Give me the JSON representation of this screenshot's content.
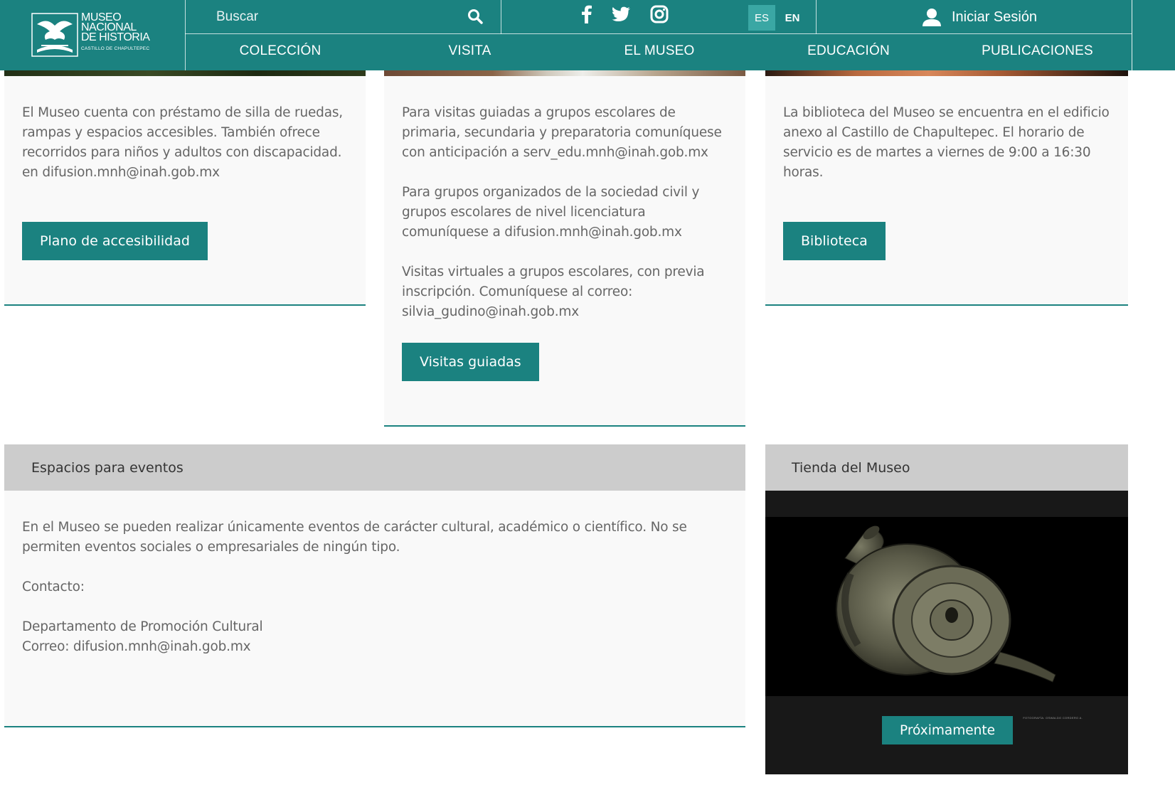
{
  "header": {
    "logo": {
      "line1": "MUSEO",
      "line2": "NACIONAL",
      "line3": "DE HISTORIA",
      "line4": "CASTILLO DE CHAPULTEPEC"
    },
    "search": {
      "placeholder": "Buscar"
    },
    "social": [
      "facebook-icon",
      "twitter-icon",
      "instagram-icon"
    ],
    "languages": {
      "es": "ES",
      "en": "EN"
    },
    "login_label": "Iniciar Sesión",
    "nav": [
      "COLECCIÓN",
      "VISITA",
      "EL MUSEO",
      "EDUCACIÓN",
      "PUBLICACIONES"
    ]
  },
  "cards": {
    "accessibility": {
      "text": "El Museo cuenta con préstamo de silla de ruedas, rampas y espacios accesibles. También ofrece recorridos para niños y adultos con discapacidad. en difusion.mnh@inah.gob.mx",
      "button": "Plano de accesibilidad"
    },
    "visits": {
      "p1": "Para visitas guiadas a grupos escolares de primaria, secundaria y preparatoria comuníquese con anticipación a serv_edu.mnh@inah.gob.mx",
      "p2": "Para grupos organizados de la sociedad civil y grupos escolares de nivel licenciatura comuníquese a difusion.mnh@inah.gob.mx",
      "p3": "Visitas virtuales a grupos escolares, con previa inscripción.  Comuníquese   al correo: silvia_gudino@inah.gob.mx",
      "button": "Visitas guiadas"
    },
    "library": {
      "text": "La biblioteca del Museo se encuentra en el edificio anexo al Castillo de Chapultepec. El horario de servicio es de martes a viernes de 9:00 a 16:30 horas.",
      "button": "Biblioteca"
    }
  },
  "events": {
    "title": "Espacios para eventos",
    "p1": "En el Museo se pueden realizar únicamente eventos de carácter cultural, académico o científico. No se permiten eventos sociales o empresariales de ningún tipo.",
    "p2": "Contacto:",
    "p3_line1": "Departamento de Promoción Cultural",
    "p3_line2": "Correo: difusion.mnh@inah.gob.mx"
  },
  "shop": {
    "title": "Tienda del Museo",
    "photo_credit": "FOTOGRAFÍA: OSWALDO CORDERO A.",
    "button": "Próximamente"
  },
  "colors": {
    "accent": "#1b8280",
    "card_bg": "#f9f9f9",
    "gray_header": "#cccccc",
    "shop_bg": "#181818"
  }
}
